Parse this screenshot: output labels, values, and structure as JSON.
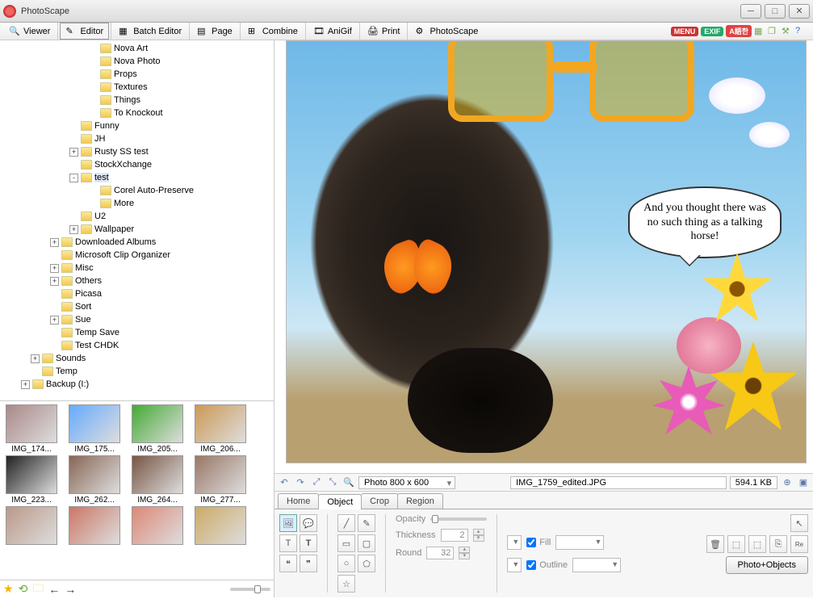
{
  "window": {
    "title": "PhotoScape"
  },
  "toolbar": {
    "tabs": [
      "Viewer",
      "Editor",
      "Batch Editor",
      "Page",
      "Combine",
      "AniGif",
      "Print",
      "PhotoScape"
    ],
    "active": 1,
    "badges": [
      "MENU",
      "EXIF",
      "A語한"
    ]
  },
  "tree": [
    {
      "d": 9,
      "e": "",
      "t": "Nova Art"
    },
    {
      "d": 9,
      "e": "",
      "t": "Nova Photo"
    },
    {
      "d": 9,
      "e": "",
      "t": "Props"
    },
    {
      "d": 9,
      "e": "",
      "t": "Textures"
    },
    {
      "d": 9,
      "e": "",
      "t": "Things"
    },
    {
      "d": 9,
      "e": "",
      "t": "To Knockout"
    },
    {
      "d": 7,
      "e": "",
      "t": "Funny"
    },
    {
      "d": 7,
      "e": "",
      "t": "JH"
    },
    {
      "d": 7,
      "e": "+",
      "t": "Rusty SS test"
    },
    {
      "d": 7,
      "e": "",
      "t": "StockXchange"
    },
    {
      "d": 7,
      "e": "-",
      "t": "test",
      "sel": true
    },
    {
      "d": 9,
      "e": "",
      "t": "Corel Auto-Preserve"
    },
    {
      "d": 9,
      "e": "",
      "t": "More"
    },
    {
      "d": 7,
      "e": "",
      "t": "U2"
    },
    {
      "d": 7,
      "e": "+",
      "t": "Wallpaper"
    },
    {
      "d": 5,
      "e": "+",
      "t": "Downloaded Albums"
    },
    {
      "d": 5,
      "e": "",
      "t": "Microsoft Clip Organizer"
    },
    {
      "d": 5,
      "e": "+",
      "t": "Misc"
    },
    {
      "d": 5,
      "e": "+",
      "t": "Others"
    },
    {
      "d": 5,
      "e": "",
      "t": "Picasa"
    },
    {
      "d": 5,
      "e": "",
      "t": "Sort"
    },
    {
      "d": 5,
      "e": "+",
      "t": "Sue"
    },
    {
      "d": 5,
      "e": "",
      "t": "Temp Save"
    },
    {
      "d": 5,
      "e": "",
      "t": "Test CHDK"
    },
    {
      "d": 3,
      "e": "+",
      "t": "Sounds"
    },
    {
      "d": 3,
      "e": "",
      "t": "Temp"
    },
    {
      "d": 2,
      "e": "+",
      "t": "Backup (I:)"
    }
  ],
  "thumbs": [
    "IMG_174...",
    "IMG_175...",
    "IMG_205...",
    "IMG_206...",
    "IMG_223...",
    "IMG_262...",
    "IMG_264...",
    "IMG_277..."
  ],
  "speech": "And you thought there was no such thing as a talking horse!",
  "status": {
    "photosize": "Photo 800 x 600",
    "filename": "IMG_1759_edited.JPG",
    "filesize": "594.1 KB"
  },
  "editTabs": [
    "Home",
    "Object",
    "Crop",
    "Region"
  ],
  "editTabActive": 1,
  "props": {
    "opacity": "Opacity",
    "thickness_label": "Thickness",
    "thickness_value": "2",
    "round_label": "Round",
    "round_value": "32",
    "fill": "Fill",
    "outline": "Outline"
  },
  "bigbtn": "Photo+Objects"
}
